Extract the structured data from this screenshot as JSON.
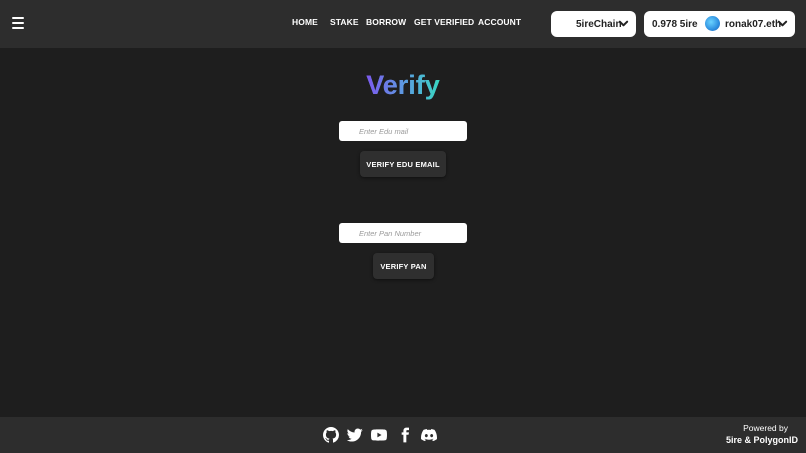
{
  "header": {
    "nav": {
      "home": "HOME",
      "stake": "STAKE",
      "borrow": "BORROW",
      "get_verified": "GET VERIFIED",
      "account": "ACCOUNT"
    },
    "chain_label": "5ireChain",
    "wallet": {
      "balance": "0.978 5ire",
      "ens": "ronak07.eth"
    }
  },
  "main": {
    "title": "Verify",
    "edu_email": {
      "placeholder": "Enter Edu mail",
      "button_label": "VERIFY EDU EMAIL"
    },
    "pan": {
      "placeholder": "Enter Pan Number",
      "button_label": "VERIFY PAN"
    }
  },
  "footer": {
    "social_icons": [
      "github-icon",
      "twitter-icon",
      "youtube-icon",
      "facebook-icon",
      "discord-icon"
    ],
    "powered_by_line1": "Powered by",
    "powered_by_line2": "5ire & PolygonID"
  },
  "colors": {
    "background": "#1e1e1e",
    "bar": "#2d2d2d",
    "button": "#2f2f2f",
    "title_gradient_start": "#7d58ee",
    "title_gradient_end": "#38d8c0"
  }
}
